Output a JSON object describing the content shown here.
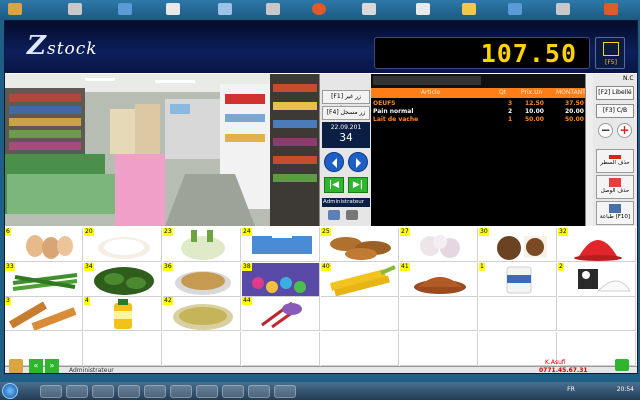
{
  "app": {
    "logo_letter": "Z",
    "logo_rest": "stock",
    "total": "107.50",
    "f5_label": "[F5]"
  },
  "clock": {
    "date": "22.09.201",
    "time": "34"
  },
  "controls": {
    "f1_label": "[F1] زر غير مسجل",
    "f4_label": "[F4] زر مسجل",
    "user_label": "Administrateur"
  },
  "ticket": {
    "nc": "N.C",
    "columns": [
      "Article",
      "Qt",
      "Prix.Un",
      "MONTANT"
    ],
    "rows": [
      {
        "article": "OEUFS",
        "qt": "3",
        "prix": "12.50",
        "montant": "37.50",
        "color": "#ff8a1c"
      },
      {
        "article": "Pain normal",
        "qt": "2",
        "prix": "10.00",
        "montant": "20.00",
        "color": "#ffffff"
      },
      {
        "article": "Lait de vache",
        "qt": "1",
        "prix": "50.00",
        "montant": "50.00",
        "color": "#ff8a1c"
      }
    ]
  },
  "right": {
    "f2_label": "[F2] Libellé",
    "f3_label": "[F3] C/B",
    "minus": "−",
    "plus": "+",
    "delete_line": "حذف السطر",
    "delete_receipt": "حذف الوصل",
    "print_label": "طباعة [F10]"
  },
  "products": [
    {
      "num": "6",
      "kind": "eggs"
    },
    {
      "num": "20",
      "kind": "rice"
    },
    {
      "num": "23",
      "kind": "fennel"
    },
    {
      "num": "24",
      "kind": "tissue"
    },
    {
      "num": "25",
      "kind": "yams"
    },
    {
      "num": "27",
      "kind": "garlic"
    },
    {
      "num": "30",
      "kind": "coconut"
    },
    {
      "num": "32",
      "kind": "jelly"
    },
    {
      "num": "33",
      "kind": "beans"
    },
    {
      "num": "34",
      "kind": "spinach"
    },
    {
      "num": "36",
      "kind": "seeds"
    },
    {
      "num": "38",
      "kind": "candy"
    },
    {
      "num": "40",
      "kind": "corn"
    },
    {
      "num": "41",
      "kind": "spice"
    },
    {
      "num": "1",
      "kind": "yogurt"
    },
    {
      "num": "2",
      "kind": "milk"
    },
    {
      "num": "3",
      "kind": "bread"
    },
    {
      "num": "4",
      "kind": "oil"
    },
    {
      "num": "42",
      "kind": "dish"
    },
    {
      "num": "44",
      "kind": "saffron"
    }
  ],
  "status": {
    "user": "Administrateur",
    "company": "K.Asufi",
    "phone": "0771.45.67.31"
  },
  "taskbar": {
    "lang": "FR",
    "time": "20:54"
  }
}
